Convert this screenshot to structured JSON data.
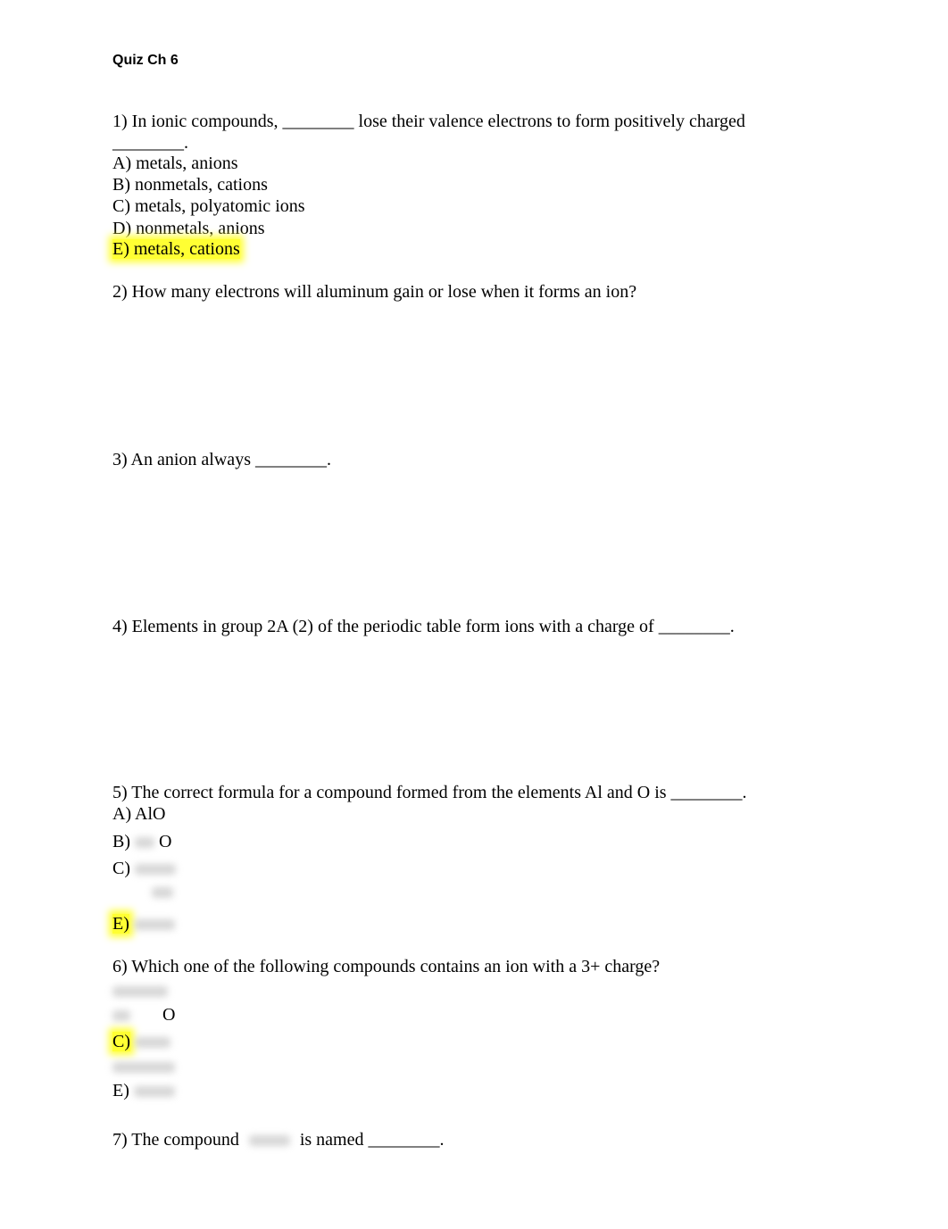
{
  "document": {
    "title": "Quiz Ch 6",
    "q1": {
      "text": "1) In ionic compounds, ________ lose their valence electrons to form positively charged",
      "text_cont": "________.",
      "options": [
        "A) metals, anions",
        "B) nonmetals, cations",
        "C) metals, polyatomic ions",
        "D) nonmetals, anions",
        "E) metals, cations"
      ],
      "highlighted": "E"
    },
    "q2": {
      "text": "2) How many electrons will aluminum gain or lose when it forms an ion?"
    },
    "q3": {
      "text": "3) An anion always ________."
    },
    "q4": {
      "text": "4) Elements in group 2A (2) of the periodic table form ions with a charge of ________."
    },
    "q5": {
      "text": "5) The correct formula for a compound formed from the elements Al and O is ________.",
      "options": [
        "A) AlO",
        "B)",
        "C)",
        "E)"
      ],
      "b_suffix": "O",
      "highlighted": "E"
    },
    "q6": {
      "text": "6) Which one of the following compounds contains an ion with a 3+ charge?",
      "b_suffix": "O",
      "options": [
        "C)",
        "E)"
      ],
      "highlighted": "C"
    },
    "q7": {
      "prefix": "7) The compound",
      "suffix": "is named ________."
    }
  }
}
